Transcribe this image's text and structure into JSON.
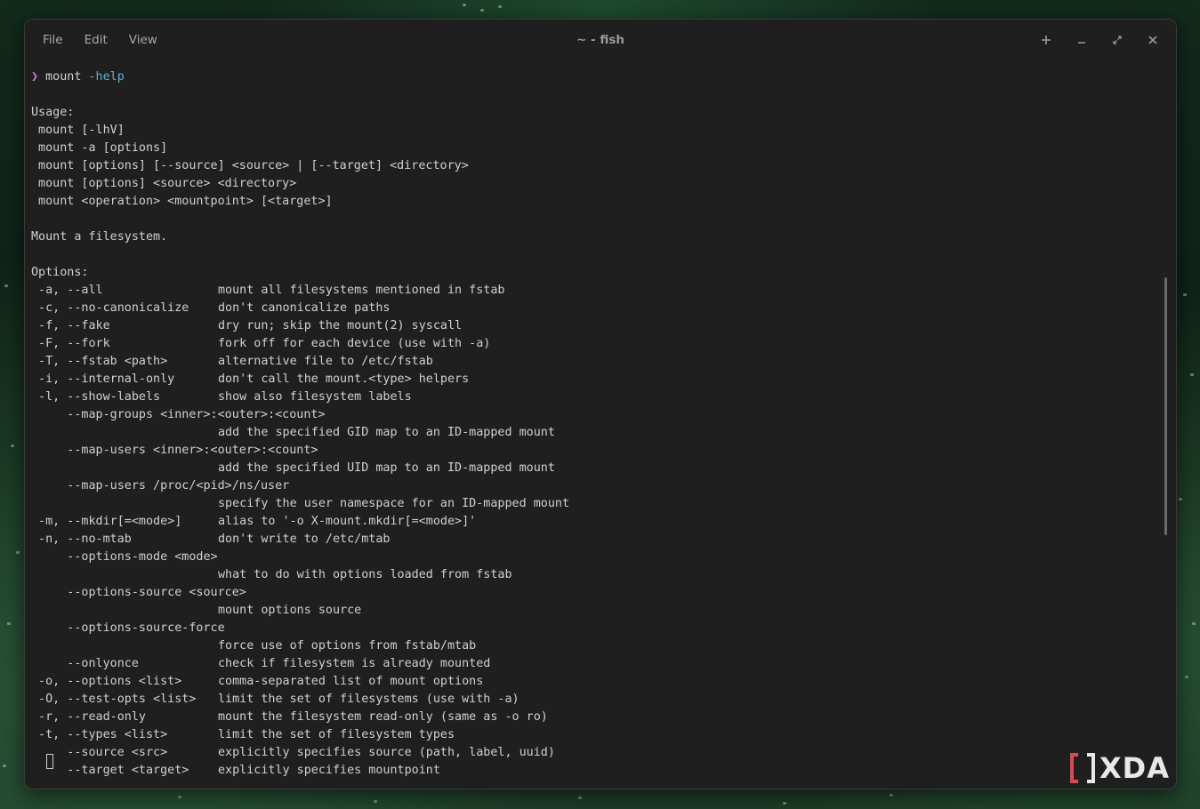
{
  "window": {
    "title": "~ - fish",
    "menu": [
      "File",
      "Edit",
      "View"
    ],
    "controls": {
      "new_tab": "+",
      "minimize": "–",
      "maximize": "⤢",
      "close": "✕"
    }
  },
  "terminal": {
    "prompt": {
      "symbol": "❯",
      "command": "mount",
      "argument": "-help"
    },
    "usage_header": "Usage:",
    "usage_lines": [
      " mount [-lhV]",
      " mount -a [options]",
      " mount [options] [--source] <source> | [--target] <directory>",
      " mount [options] <source> <directory>",
      " mount <operation> <mountpoint> [<target>]"
    ],
    "description": "Mount a filesystem.",
    "options_header": "Options:",
    "options": [
      {
        "flag": " -a, --all",
        "desc": "mount all filesystems mentioned in fstab"
      },
      {
        "flag": " -c, --no-canonicalize",
        "desc": "don't canonicalize paths"
      },
      {
        "flag": " -f, --fake",
        "desc": "dry run; skip the mount(2) syscall"
      },
      {
        "flag": " -F, --fork",
        "desc": "fork off for each device (use with -a)"
      },
      {
        "flag": " -T, --fstab <path>",
        "desc": "alternative file to /etc/fstab"
      },
      {
        "flag": " -i, --internal-only",
        "desc": "don't call the mount.<type> helpers"
      },
      {
        "flag": " -l, --show-labels",
        "desc": "show also filesystem labels"
      },
      {
        "flag": "     --map-groups <inner>:<outer>:<count>",
        "desc": ""
      },
      {
        "flag": "",
        "desc": "add the specified GID map to an ID-mapped mount"
      },
      {
        "flag": "     --map-users <inner>:<outer>:<count>",
        "desc": ""
      },
      {
        "flag": "",
        "desc": "add the specified UID map to an ID-mapped mount"
      },
      {
        "flag": "     --map-users /proc/<pid>/ns/user",
        "desc": ""
      },
      {
        "flag": "",
        "desc": "specify the user namespace for an ID-mapped mount"
      },
      {
        "flag": " -m, --mkdir[=<mode>]",
        "desc": "alias to '-o X-mount.mkdir[=<mode>]'"
      },
      {
        "flag": " -n, --no-mtab",
        "desc": "don't write to /etc/mtab"
      },
      {
        "flag": "     --options-mode <mode>",
        "desc": ""
      },
      {
        "flag": "",
        "desc": "what to do with options loaded from fstab"
      },
      {
        "flag": "     --options-source <source>",
        "desc": ""
      },
      {
        "flag": "",
        "desc": "mount options source"
      },
      {
        "flag": "     --options-source-force",
        "desc": ""
      },
      {
        "flag": "",
        "desc": "force use of options from fstab/mtab"
      },
      {
        "flag": "     --onlyonce",
        "desc": "check if filesystem is already mounted"
      },
      {
        "flag": " -o, --options <list>",
        "desc": "comma-separated list of mount options"
      },
      {
        "flag": " -O, --test-opts <list>",
        "desc": "limit the set of filesystems (use with -a)"
      },
      {
        "flag": " -r, --read-only",
        "desc": "mount the filesystem read-only (same as -o ro)"
      },
      {
        "flag": " -t, --types <list>",
        "desc": "limit the set of filesystem types"
      },
      {
        "flag": "     --source <src>",
        "desc": "explicitly specifies source (path, label, uuid)"
      },
      {
        "flag": "     --target <target>",
        "desc": "explicitly specifies mountpoint"
      }
    ]
  },
  "watermark": {
    "text": "XDA",
    "mark": "[ ]"
  }
}
